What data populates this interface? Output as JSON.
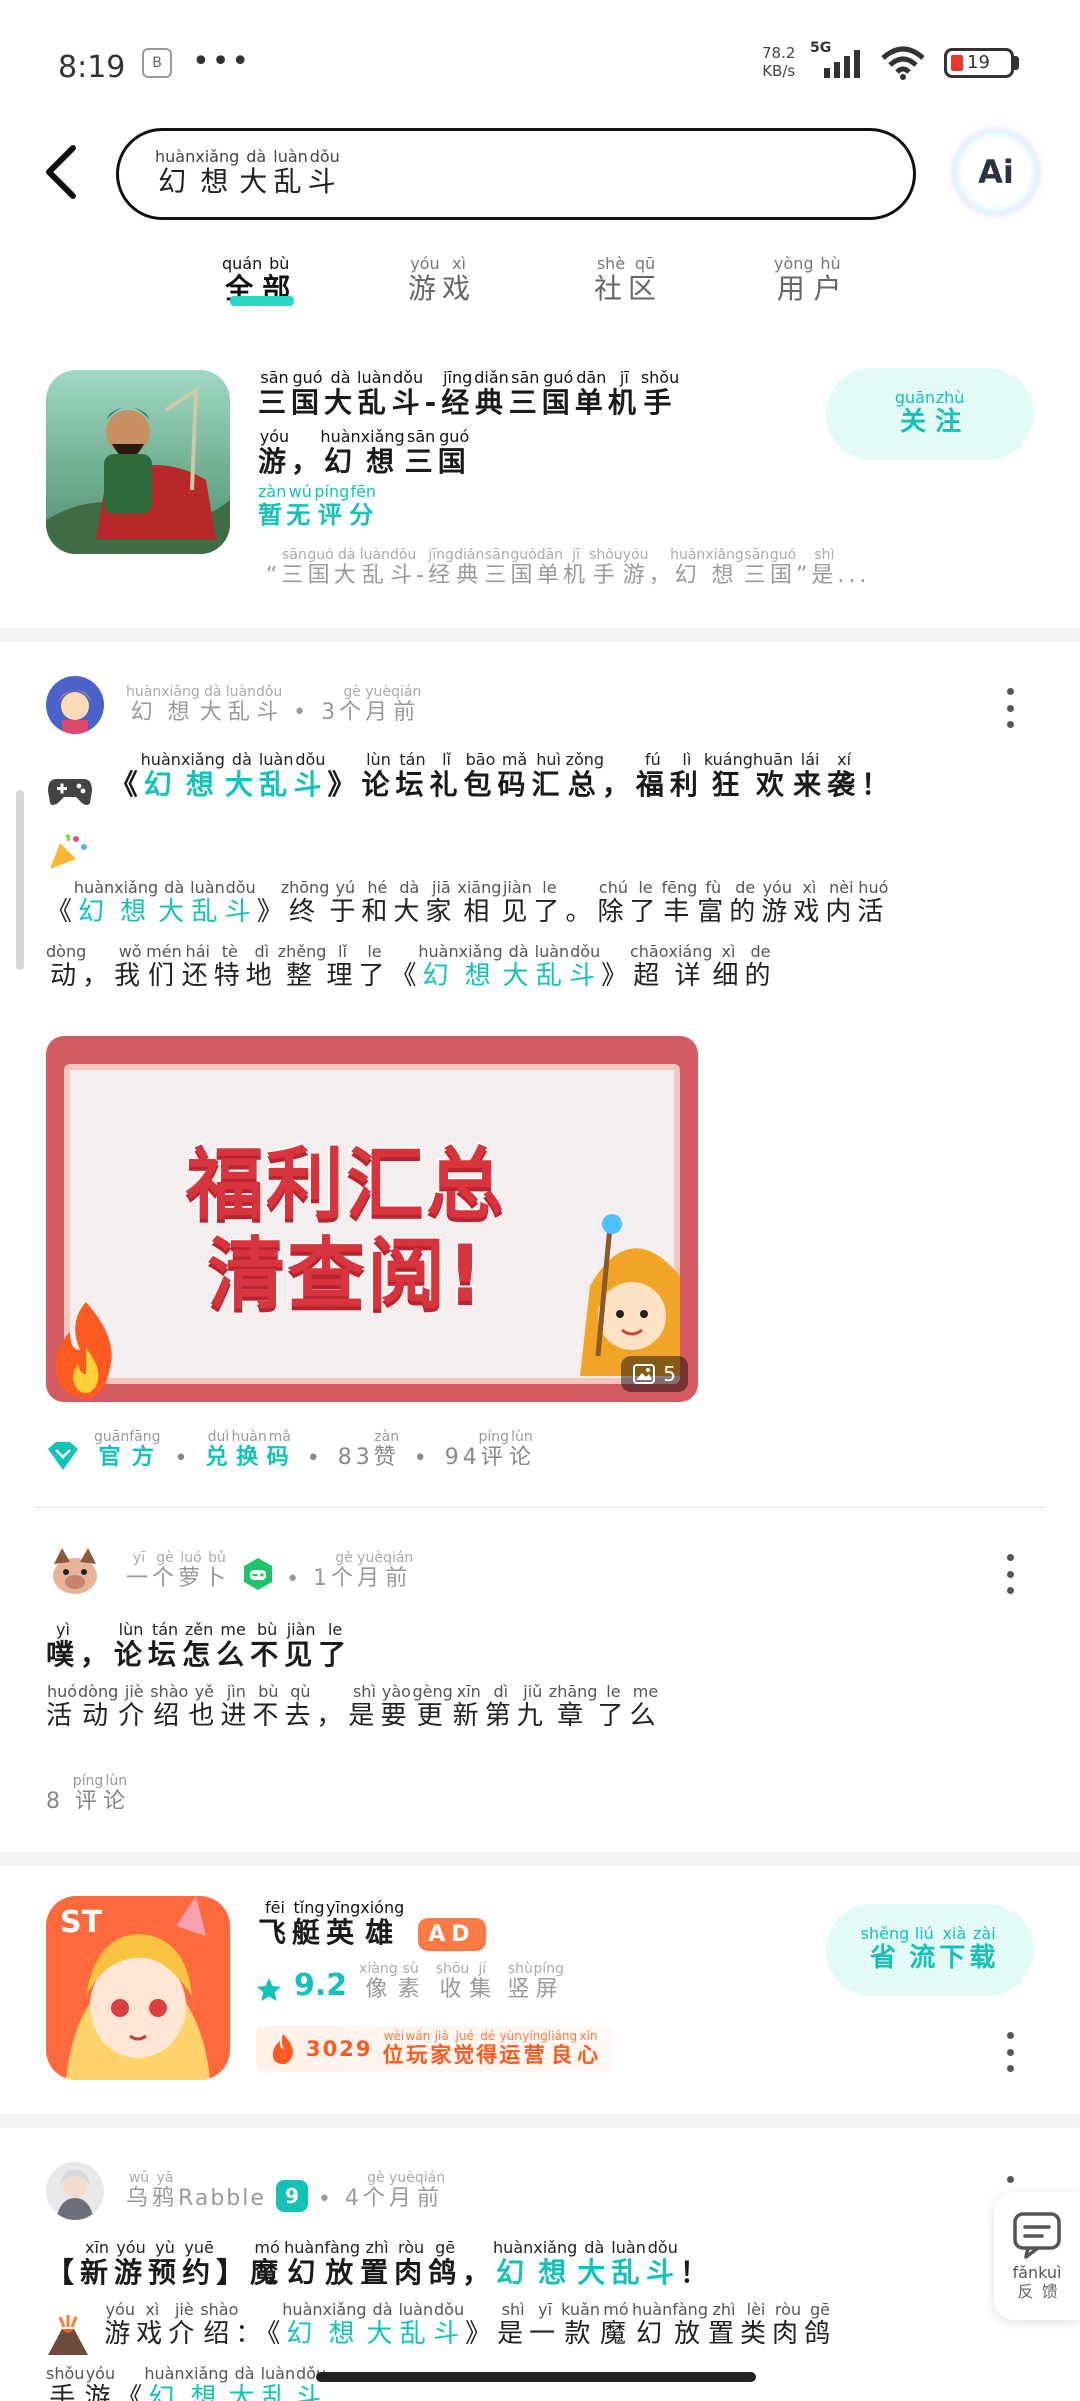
{
  "status_bar": {
    "time": "8:19",
    "app_icon_glyph": "B",
    "dots": "•••",
    "net_speed_value": "78.2",
    "net_speed_unit": "KB/s",
    "network": "5G",
    "battery": "19"
  },
  "search": {
    "query_ruby": [
      [
        "幻",
        "huàn"
      ],
      [
        "想",
        "xiǎng"
      ],
      [
        "大",
        "dà"
      ],
      [
        "乱",
        "luàn"
      ],
      [
        "斗",
        "dǒu"
      ]
    ],
    "ai_label": "Ai"
  },
  "tabs": [
    {
      "label": [
        [
          "全",
          "quán"
        ],
        [
          "部",
          "bù"
        ]
      ],
      "active": true
    },
    {
      "label": [
        [
          "游",
          "yóu"
        ],
        [
          "戏",
          "xì"
        ]
      ],
      "active": false
    },
    {
      "label": [
        [
          "社",
          "shè"
        ],
        [
          "区",
          "qū"
        ]
      ],
      "active": false
    },
    {
      "label": [
        [
          "用",
          "yòng"
        ],
        [
          "户",
          "hù"
        ]
      ],
      "active": false
    }
  ],
  "app_card": {
    "title_line1": [
      [
        "三",
        "sān"
      ],
      [
        "国",
        "guó"
      ],
      [
        "大",
        "dà"
      ],
      [
        "乱",
        "luàn"
      ],
      [
        "斗",
        "dǒu"
      ],
      [
        "-",
        ""
      ],
      [
        "经",
        "jīng"
      ],
      [
        "典",
        "diǎn"
      ],
      [
        "三",
        "sān"
      ],
      [
        "国",
        "guó"
      ],
      [
        "单",
        "dān"
      ],
      [
        "机",
        "jī"
      ],
      [
        "手",
        "shǒu"
      ]
    ],
    "title_line2": [
      [
        "游",
        "yóu"
      ],
      [
        "，",
        ""
      ],
      [
        "幻",
        "huàn"
      ],
      [
        "想",
        "xiǎng"
      ],
      [
        "三",
        "sān"
      ],
      [
        "国",
        "guó"
      ]
    ],
    "rating": [
      [
        "暂",
        "zàn"
      ],
      [
        "无",
        "wú"
      ],
      [
        "评",
        "píng"
      ],
      [
        "分",
        "fēn"
      ]
    ],
    "follow": [
      [
        "关",
        "guān"
      ],
      [
        "注",
        "zhù"
      ]
    ],
    "desc": [
      [
        "“",
        ""
      ],
      [
        "三",
        "sān"
      ],
      [
        "国",
        "guó"
      ],
      [
        "大",
        "dà"
      ],
      [
        "乱",
        "luàn"
      ],
      [
        "斗",
        "dǒu"
      ],
      [
        "-",
        ""
      ],
      [
        "经",
        "jīng"
      ],
      [
        "典",
        "diǎn"
      ],
      [
        "三",
        "sān"
      ],
      [
        "国",
        "guó"
      ],
      [
        "单",
        "dān"
      ],
      [
        "机",
        "jī"
      ],
      [
        "手",
        "shǒu"
      ],
      [
        "游",
        "yóu"
      ],
      [
        "，",
        ""
      ],
      [
        "幻",
        "huàn"
      ],
      [
        "想",
        "xiǎng"
      ],
      [
        "三",
        "sān"
      ],
      [
        "国",
        "guó"
      ],
      [
        "”",
        ""
      ],
      [
        "是",
        "shì"
      ],
      [
        "...",
        ""
      ]
    ]
  },
  "post1": {
    "author": [
      [
        "幻",
        "huàn"
      ],
      [
        "想",
        "xiǎng"
      ],
      [
        "大",
        "dà"
      ],
      [
        "乱",
        "luàn"
      ],
      [
        "斗",
        "dǒu"
      ]
    ],
    "time": [
      [
        "3",
        ""
      ],
      [
        "个",
        "gè"
      ],
      [
        "月",
        "yuè"
      ],
      [
        "前",
        "qián"
      ]
    ],
    "title_prefix": "《",
    "title_game": [
      [
        "幻",
        "huàn"
      ],
      [
        "想",
        "xiǎng"
      ],
      [
        "大",
        "dà"
      ],
      [
        "乱",
        "luàn"
      ],
      [
        "斗",
        "dǒu"
      ]
    ],
    "title_rest": [
      [
        "》",
        ""
      ],
      [
        "论",
        "lùn"
      ],
      [
        "坛",
        "tán"
      ],
      [
        "礼",
        "lǐ"
      ],
      [
        "包",
        "bāo"
      ],
      [
        "码",
        "mǎ"
      ],
      [
        "汇",
        "huì"
      ],
      [
        "总",
        "zǒng"
      ],
      [
        "，",
        ""
      ],
      [
        "福",
        "fú"
      ],
      [
        "利",
        "lì"
      ],
      [
        "狂",
        "kuáng"
      ],
      [
        "欢",
        "huān"
      ],
      [
        "来",
        "lái"
      ],
      [
        "袭",
        "xí"
      ],
      [
        "！",
        ""
      ]
    ],
    "body_line1_game": [
      [
        "幻",
        "huàn"
      ],
      [
        "想",
        "xiǎng"
      ],
      [
        "大",
        "dà"
      ],
      [
        "乱",
        "luàn"
      ],
      [
        "斗",
        "dǒu"
      ]
    ],
    "body_line1_rest": [
      [
        "》",
        ""
      ],
      [
        "终",
        "zhōng"
      ],
      [
        "于",
        "yú"
      ],
      [
        "和",
        "hé"
      ],
      [
        "大",
        "dà"
      ],
      [
        "家",
        "jiā"
      ],
      [
        "相",
        "xiāng"
      ],
      [
        "见",
        "jiàn"
      ],
      [
        "了",
        "le"
      ],
      [
        "。",
        ""
      ],
      [
        "除",
        "chú"
      ],
      [
        "了",
        "le"
      ],
      [
        "丰",
        "fēng"
      ],
      [
        "富",
        "fù"
      ],
      [
        "的",
        "de"
      ],
      [
        "游",
        "yóu"
      ],
      [
        "戏",
        "xì"
      ],
      [
        "内",
        "nèi"
      ],
      [
        "活",
        "huó"
      ]
    ],
    "body_line2_start": [
      [
        "动",
        "dòng"
      ],
      [
        "，",
        ""
      ],
      [
        "我",
        "wǒ"
      ],
      [
        "们",
        "mén"
      ],
      [
        "还",
        "hái"
      ],
      [
        "特",
        "tè"
      ],
      [
        "地",
        "dì"
      ],
      [
        "整",
        "zhěng"
      ],
      [
        "理",
        "lǐ"
      ],
      [
        "了",
        "le"
      ],
      [
        "《",
        ""
      ]
    ],
    "body_line2_game": [
      [
        "幻",
        "huàn"
      ],
      [
        "想",
        "xiǎng"
      ],
      [
        "大",
        "dà"
      ],
      [
        "乱",
        "luàn"
      ],
      [
        "斗",
        "dǒu"
      ]
    ],
    "body_line2_end": [
      [
        "》",
        ""
      ],
      [
        "超",
        "chāo"
      ],
      [
        "详",
        "xiáng"
      ],
      [
        "细",
        "xì"
      ],
      [
        "的",
        "de"
      ]
    ],
    "image_text_line1": "福利汇总",
    "image_text_line2": "清查阅!",
    "image_count": "5",
    "tag_official": [
      [
        "官",
        "guān"
      ],
      [
        "方",
        "fāng"
      ]
    ],
    "tag_code": [
      [
        "兑",
        "duì"
      ],
      [
        "换",
        "huàn"
      ],
      [
        "码",
        "mǎ"
      ]
    ],
    "likes": "83",
    "likes_label": [
      [
        "赞",
        "zàn"
      ]
    ],
    "comments": "94",
    "comments_label": [
      [
        "评",
        "píng"
      ],
      [
        "论",
        "lùn"
      ]
    ]
  },
  "post2": {
    "author": [
      [
        "一",
        "yī"
      ],
      [
        "个",
        "gè"
      ],
      [
        "萝",
        "luó"
      ],
      [
        "卜",
        "bǔ"
      ]
    ],
    "time": [
      [
        "1",
        ""
      ],
      [
        "个",
        "gè"
      ],
      [
        "月",
        "yuè"
      ],
      [
        "前",
        "qián"
      ]
    ],
    "title": [
      [
        "噗",
        "yì"
      ],
      [
        "，",
        ""
      ],
      [
        "论",
        "lùn"
      ],
      [
        "坛",
        "tán"
      ],
      [
        "怎",
        "zěn"
      ],
      [
        "么",
        "me"
      ],
      [
        "不",
        "bù"
      ],
      [
        "见",
        "jiàn"
      ],
      [
        "了",
        "le"
      ]
    ],
    "body": [
      [
        "活",
        "huó"
      ],
      [
        "动",
        "dòng"
      ],
      [
        "介",
        "jiè"
      ],
      [
        "绍",
        "shào"
      ],
      [
        "也",
        "yě"
      ],
      [
        "进",
        "jìn"
      ],
      [
        "不",
        "bù"
      ],
      [
        "去",
        "qù"
      ],
      [
        "，",
        ""
      ],
      [
        "是",
        "shì"
      ],
      [
        "要",
        "yào"
      ],
      [
        "更",
        "gèng"
      ],
      [
        "新",
        "xīn"
      ],
      [
        "第",
        "dì"
      ],
      [
        "九",
        "jiǔ"
      ],
      [
        "章",
        "zhāng"
      ],
      [
        "了",
        "le"
      ],
      [
        "么",
        "me"
      ]
    ],
    "comments": "8",
    "comments_label": [
      [
        "评",
        "píng"
      ],
      [
        "论",
        "lùn"
      ]
    ]
  },
  "app2": {
    "name": [
      [
        "飞",
        "fēi"
      ],
      [
        "艇",
        "tǐng"
      ],
      [
        "英",
        "yīng"
      ],
      [
        "雄",
        "xióng"
      ]
    ],
    "ad": "AD",
    "score": "9.2",
    "tags": [
      [
        [
          "像",
          "xiàng"
        ],
        [
          "素",
          "sù"
        ]
      ],
      [
        [
          "收",
          "shōu"
        ],
        [
          "集",
          "jí"
        ]
      ],
      [
        [
          "竖",
          "shù"
        ],
        [
          "屏",
          "píng"
        ]
      ]
    ],
    "hot_count": "3029",
    "hot_text": [
      [
        "位",
        "wèi"
      ],
      [
        "玩",
        "wán"
      ],
      [
        "家",
        "jiā"
      ],
      [
        "觉",
        "jué"
      ],
      [
        "得",
        "dé"
      ],
      [
        "运",
        "yùn"
      ],
      [
        "营",
        "yíng"
      ],
      [
        "良",
        "liáng"
      ],
      [
        "心",
        "xīn"
      ]
    ],
    "download": [
      [
        "省",
        "shěng"
      ],
      [
        "流",
        "liú"
      ],
      [
        "下",
        "xià"
      ],
      [
        "载",
        "zài"
      ]
    ]
  },
  "post3": {
    "author_ruby": [
      [
        "乌",
        "wū"
      ],
      [
        "鸦",
        "yā"
      ]
    ],
    "author_latin": "Rabble",
    "level": "9",
    "time": [
      [
        "4",
        ""
      ],
      [
        "个",
        "gè"
      ],
      [
        "月",
        "yuè"
      ],
      [
        "前",
        "qián"
      ]
    ],
    "title_start": [
      [
        "【",
        ""
      ],
      [
        "新",
        "xīn"
      ],
      [
        "游",
        "yóu"
      ],
      [
        "预",
        "yù"
      ],
      [
        "约",
        "yuē"
      ],
      [
        "】",
        ""
      ],
      [
        "魔",
        "mó"
      ],
      [
        "幻",
        "huàn"
      ],
      [
        "放",
        "fàng"
      ],
      [
        "置",
        "zhì"
      ],
      [
        "肉",
        "ròu"
      ],
      [
        "鸽",
        "gē"
      ],
      [
        "，",
        ""
      ]
    ],
    "title_game": [
      [
        "幻",
        "huàn"
      ],
      [
        "想",
        "xiǎng"
      ],
      [
        "大",
        "dà"
      ],
      [
        "乱",
        "luàn"
      ],
      [
        "斗",
        "dǒu"
      ]
    ],
    "title_end": [
      [
        "！",
        ""
      ]
    ],
    "body_start": [
      [
        "游",
        "yóu"
      ],
      [
        "戏",
        "xì"
      ],
      [
        "介",
        "jiè"
      ],
      [
        "绍",
        "shào"
      ],
      [
        "：",
        ""
      ],
      [
        "《",
        ""
      ]
    ],
    "body_game": [
      [
        "幻",
        "huàn"
      ],
      [
        "想",
        "xiǎng"
      ],
      [
        "大",
        "dà"
      ],
      [
        "乱",
        "luàn"
      ],
      [
        "斗",
        "dǒu"
      ]
    ],
    "body_end": [
      [
        "》",
        ""
      ],
      [
        "是",
        "shì"
      ],
      [
        "一",
        "yī"
      ],
      [
        "款",
        "kuǎn"
      ],
      [
        "魔",
        "mó"
      ],
      [
        "幻",
        "huàn"
      ],
      [
        "放",
        "fàng"
      ],
      [
        "置",
        "zhì"
      ],
      [
        "类",
        "lèi"
      ],
      [
        "肉",
        "ròu"
      ],
      [
        "鸽",
        "gē"
      ]
    ],
    "body_line2_start": [
      [
        "手",
        "shǒu"
      ],
      [
        "游",
        "yóu"
      ],
      [
        "《",
        ""
      ]
    ],
    "body_line2_game": [
      [
        "幻",
        "huàn"
      ],
      [
        "想",
        "xiǎng"
      ],
      [
        "大",
        "dà"
      ],
      [
        "乱",
        "luàn"
      ],
      [
        "斗",
        "dǒu"
      ]
    ]
  },
  "feedback": {
    "label": [
      [
        "反",
        "fǎn"
      ],
      [
        "馈",
        "kuì"
      ]
    ]
  },
  "colors": {
    "accent": "#13c2b6",
    "tab_underline": "#2fd6c6",
    "ad_badge": "#ff7a45"
  }
}
